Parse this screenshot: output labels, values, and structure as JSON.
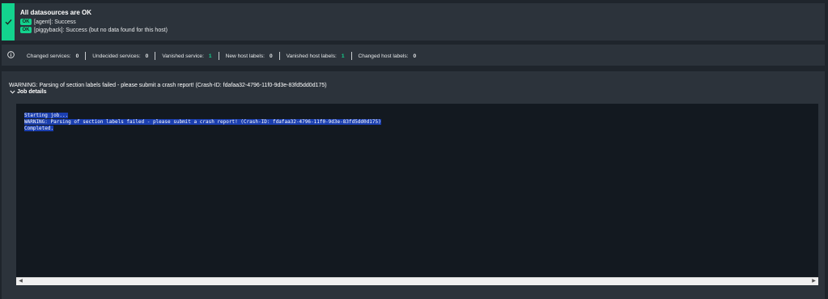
{
  "status": {
    "title": "All datasources are OK",
    "items": [
      {
        "badge": "OK",
        "text": "[agent]: Success"
      },
      {
        "badge": "OK",
        "text": "[piggyback]: Success (but no data found for this host)"
      }
    ],
    "accent": "#13d38e",
    "icon": "check-icon"
  },
  "counts": [
    {
      "label": "Changed services:",
      "value": "0"
    },
    {
      "label": "Undecided services:",
      "value": "0"
    },
    {
      "label": "Vanished service:",
      "value": "1"
    },
    {
      "label": "New host labels:",
      "value": "0"
    },
    {
      "label": "Vanished host labels:",
      "value": "1"
    },
    {
      "label": "Changed host labels:",
      "value": "0"
    }
  ],
  "main": {
    "warning": "WARNING: Parsing of section labels failed - please submit a crash report! (Crash-ID: fdafaa32-4796-11f0-9d3e-83fd5dd0d175)",
    "job_details_label": "Job details",
    "log_lines": [
      "Starting job...",
      "WARNING: Parsing of section labels failed - please submit a crash report! (Crash-ID: fdafaa32-4796-11f0-9d3e-83fd5dd0d175)",
      "Completed."
    ],
    "selection_color": "#1b3fb0"
  }
}
